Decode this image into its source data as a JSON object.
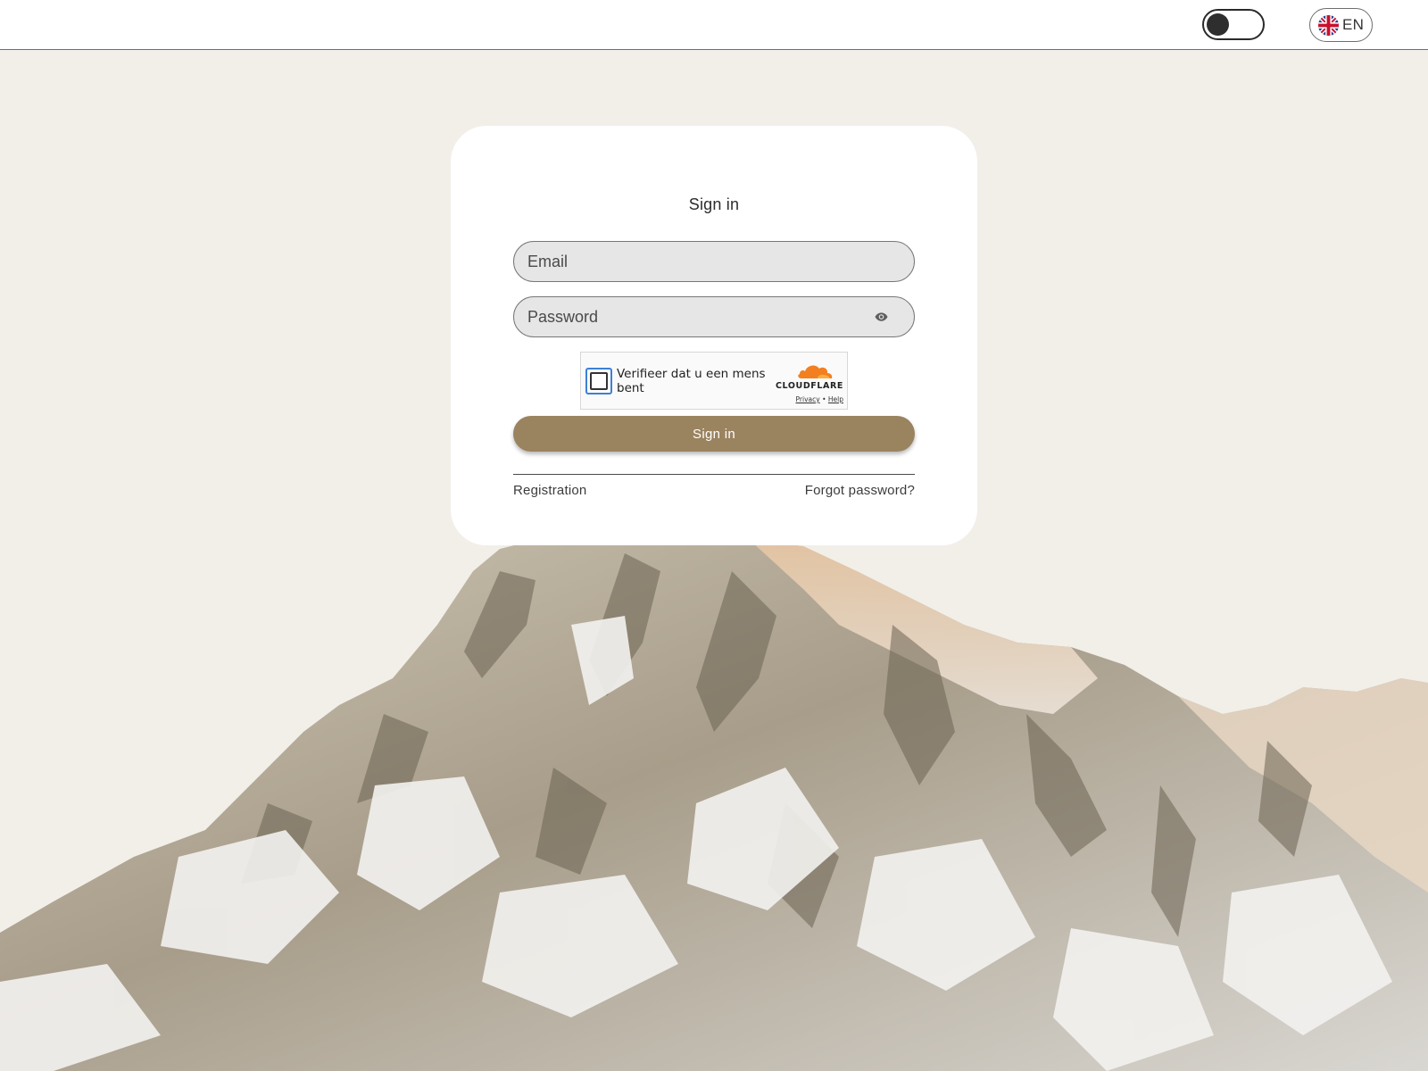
{
  "header": {
    "theme_toggle": {
      "state": "light",
      "icon": "moon-icon"
    },
    "language": {
      "code": "EN",
      "flag": "uk-flag-icon"
    }
  },
  "login": {
    "title": "Sign in",
    "email": {
      "placeholder": "Email",
      "value": ""
    },
    "password": {
      "placeholder": "Password",
      "value": "",
      "toggle_icon": "eye-icon"
    },
    "captcha": {
      "label": "Verifieer dat u een mens bent",
      "brand": "CLOUDFLARE",
      "privacy": "Privacy",
      "separator": "•",
      "help": "Help",
      "checked": false
    },
    "submit_label": "Sign in",
    "registration_label": "Registration",
    "forgot_label": "Forgot password?"
  },
  "colors": {
    "background": "#f2efe9",
    "card": "#ffffff",
    "accent_button": "#9a835f",
    "input_fill": "#e6e6e6",
    "captcha_border": "#3d7fd6",
    "cloudflare_orange": "#f38020"
  }
}
